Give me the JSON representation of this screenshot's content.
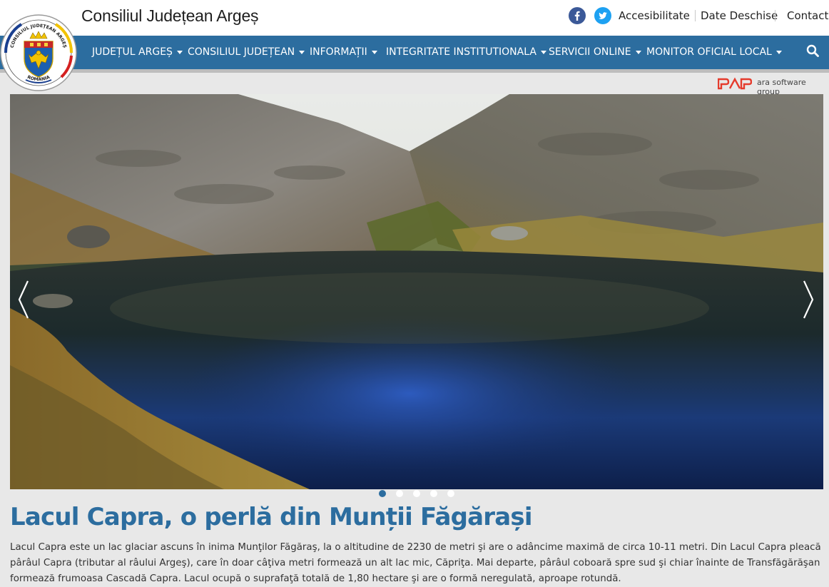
{
  "header": {
    "site_title": "Consiliul Județean Argeș",
    "links": {
      "accessibility": "Accesibilitate",
      "open_data": "Date Deschise",
      "contact": "Contact"
    },
    "logo": {
      "ring_text_top": "CONSILIUL JUDEȚEAN ARGEȘ",
      "ring_text_bottom": "ROMÂNIA"
    }
  },
  "nav": {
    "items": [
      {
        "label": "JUDEȚUL ARGEȘ"
      },
      {
        "label": "CONSILIUL JUDEȚEAN"
      },
      {
        "label": "INFORMAȚII"
      },
      {
        "label": "INTEGRITATE INSTITUTIONALA"
      },
      {
        "label": "SERVICII ONLINE"
      },
      {
        "label": "MONITOR OFICIAL LOCAL"
      }
    ]
  },
  "partner": {
    "name": "ara software group"
  },
  "slider": {
    "slide_count": 5,
    "active_index": 0
  },
  "article": {
    "title": "Lacul Capra, o perlă din Munții Făgărași",
    "body": "Lacul Capra este un lac glaciar ascuns în inima Munţilor Făgăraş, la o altitudine de 2230 de metri şi are o adâncime maximă de circa 10-11 metri. Din Lacul Capra pleacă pârâul Capra (tributar al râului Argeş), care în doar câţiva metri formează un alt lac mic, Căpriţa. Mai departe, pârâul coboară spre sud şi chiar înainte de Transfăgărăşan formează frumoasa Cascadă Capra. Lacul ocupă o suprafaţă totală de 1,80 hectare şi are o formă neregulată, aproape rotundă."
  },
  "colors": {
    "nav_background": "#2c6d9f",
    "headline": "#2c6d9f",
    "facebook": "#3b5998",
    "twitter": "#1da1f2",
    "partner_brand": "#e53b2c"
  }
}
